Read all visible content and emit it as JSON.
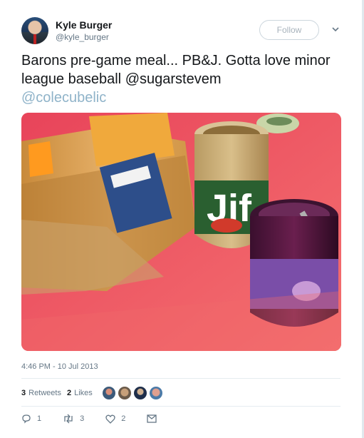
{
  "author": {
    "name": "Kyle Burger",
    "handle": "@kyle_burger"
  },
  "follow_label": "Follow",
  "tweet": {
    "text_main": "Barons pre-game meal... PB&J.  Gotta love minor league baseball ",
    "mention1": "@sugarstevem",
    "mention2": "@colecubelic"
  },
  "timestamp": "4:46 PM - 10 Jul 2013",
  "stats": {
    "retweets_count": "3",
    "retweets_label": "Retweets",
    "likes_count": "2",
    "likes_label": "Likes"
  },
  "actions": {
    "reply_count": "1",
    "retweet_count": "3",
    "like_count": "2"
  },
  "colors": {
    "text": "#14171a",
    "muted": "#657786",
    "link_faded": "#8fb3c9",
    "border": "#e6ecf0"
  },
  "icons": [
    "chevron-down-icon",
    "reply-icon",
    "retweet-icon",
    "heart-icon",
    "message-icon"
  ]
}
